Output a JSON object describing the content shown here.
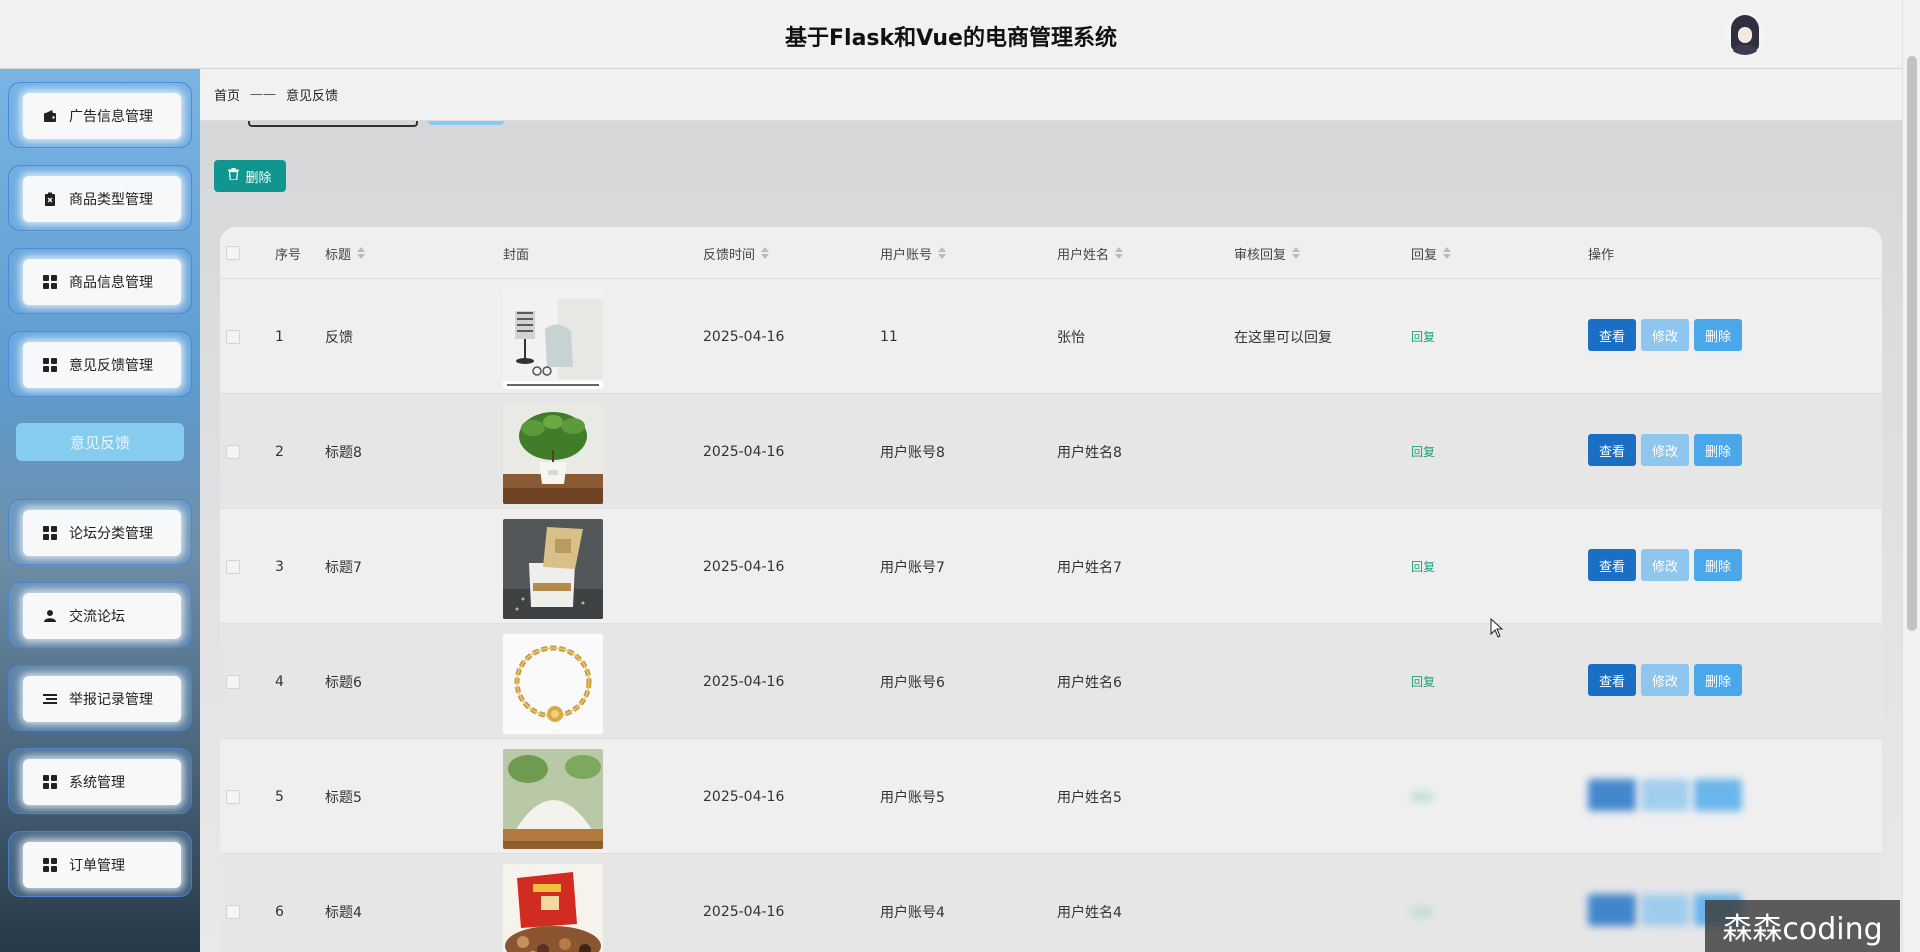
{
  "header": {
    "title": "基于Flask和Vue的电商管理系统"
  },
  "sidebar": {
    "items": [
      {
        "label": "广告信息管理",
        "icon": "wallet-icon"
      },
      {
        "label": "商品类型管理",
        "icon": "clipboard-icon"
      },
      {
        "label": "商品信息管理",
        "icon": "grid-icon"
      },
      {
        "label": "意见反馈管理",
        "icon": "grid-icon"
      },
      {
        "label": "论坛分类管理",
        "icon": "grid-icon"
      },
      {
        "label": "交流论坛",
        "icon": "user-icon"
      },
      {
        "label": "举报记录管理",
        "icon": "list-icon"
      },
      {
        "label": "系统管理",
        "icon": "grid-icon"
      },
      {
        "label": "订单管理",
        "icon": "grid-icon"
      }
    ],
    "submenu_active": "意见反馈"
  },
  "breadcrumb": {
    "home": "首页",
    "separator": "——",
    "current": "意见反馈"
  },
  "toolbar": {
    "delete_label": "删除"
  },
  "table": {
    "headers": {
      "index": "序号",
      "title": "标题",
      "cover": "封面",
      "time": "反馈时间",
      "account": "用户账号",
      "name": "用户姓名",
      "review": "审核回复",
      "reply": "回复",
      "actions": "操作"
    },
    "rows": [
      {
        "index": "1",
        "title": "反馈",
        "time": "2025-04-16",
        "account": "11",
        "name": "张怡",
        "review": "在这里可以回复",
        "reply": "回复",
        "cover": "desk-decor"
      },
      {
        "index": "2",
        "title": "标题8",
        "time": "2025-04-16",
        "account": "用户账号8",
        "name": "用户姓名8",
        "review": "",
        "reply": "回复",
        "cover": "potted-plant"
      },
      {
        "index": "3",
        "title": "标题7",
        "time": "2025-04-16",
        "account": "用户账号7",
        "name": "用户姓名7",
        "review": "",
        "reply": "回复",
        "cover": "gift-box"
      },
      {
        "index": "4",
        "title": "标题6",
        "time": "2025-04-16",
        "account": "用户账号6",
        "name": "用户姓名6",
        "review": "",
        "reply": "回复",
        "cover": "gold-bracelet"
      },
      {
        "index": "5",
        "title": "标题5",
        "time": "2025-04-16",
        "account": "用户账号5",
        "name": "用户姓名5",
        "review": "",
        "reply": "",
        "cover": "flour"
      },
      {
        "index": "6",
        "title": "标题4",
        "time": "2025-04-16",
        "account": "用户账号4",
        "name": "用户姓名4",
        "review": "",
        "reply": "",
        "cover": "nut-gift-box"
      }
    ],
    "actions": {
      "view": "查看",
      "edit": "修改",
      "delete": "删除"
    }
  },
  "watermark": "森森coding",
  "colors": {
    "primary": "#1a6fc4",
    "teal": "#11958f",
    "reply": "#1aa37a"
  }
}
